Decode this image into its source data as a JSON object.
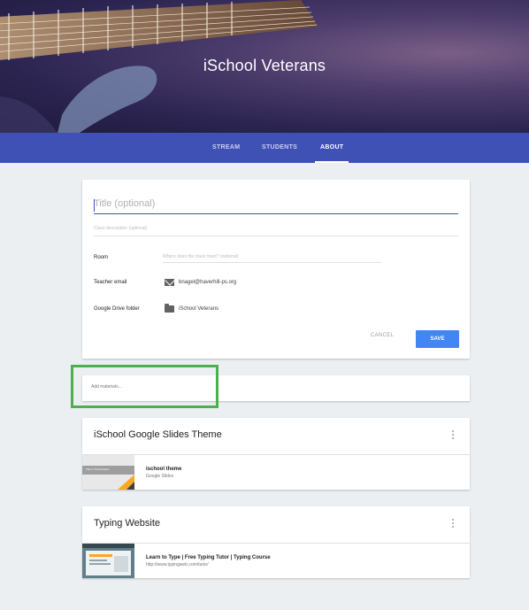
{
  "header": {
    "class_title": "iSchool Veterans"
  },
  "tabs": [
    {
      "label": "STREAM",
      "active": false
    },
    {
      "label": "STUDENTS",
      "active": false
    },
    {
      "label": "ABOUT",
      "active": true
    }
  ],
  "about": {
    "title_placeholder": "Title (optional)",
    "description_placeholder": "Class description (optional)",
    "room_label": "Room",
    "room_placeholder": "Where does the class meet? (optional)",
    "teacher_email_label": "Teacher email",
    "teacher_email_value": "bnagel@haverhill-ps.org",
    "drive_folder_label": "Google Drive folder",
    "drive_folder_value": "iSchool Veterans",
    "cancel_label": "CANCEL",
    "save_label": "SAVE"
  },
  "materials": {
    "placeholder": "Add materials..."
  },
  "posts": [
    {
      "title": "iSchool Google Slides Theme",
      "attachment_name": "ischool theme",
      "attachment_type": "Google Slides",
      "thumb_label": "Title of Presentation"
    },
    {
      "title": "Typing Website",
      "attachment_name": "Learn to Type | Free Typing Tutor | Typing Course",
      "attachment_type": "http://www.typingweb.com/tutor/"
    }
  ],
  "colors": {
    "tab_bar": "#3f51b5",
    "save_button": "#4285f4",
    "highlight_box": "#4caf50",
    "page_background": "#eceff1"
  }
}
